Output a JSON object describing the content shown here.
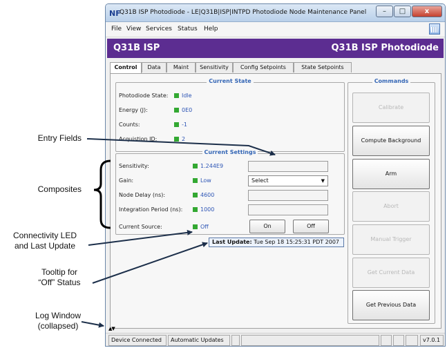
{
  "annotations": {
    "entry_fields": "Entry Fields",
    "composites": "Composites",
    "connectivity_line1": "Connectivity LED",
    "connectivity_line2": "and Last Update",
    "tooltip_line1": "Tooltip for",
    "tooltip_line2": "“Off” Status",
    "log_line1": "Log Window",
    "log_line2": "(collapsed)"
  },
  "window": {
    "logo": "NF",
    "title": "Q31B ISP Photodiode - LE|Q31B|ISP|INTPD  Photodiode Node Maintenance Panel",
    "min": "–",
    "max": "□",
    "close": "x"
  },
  "menu": [
    "File",
    "View",
    "Services",
    "Status",
    "Help"
  ],
  "header": {
    "left": "Q31B  ISP",
    "right": "Q31B ISP Photodiode"
  },
  "tabs": [
    "Control",
    "Data",
    "Maint",
    "Sensitivity",
    "Config Setpoints",
    "State Setpoints"
  ],
  "current_state": {
    "title": "Current State",
    "rows": [
      {
        "label": "Photodiode State:",
        "value": "Idle"
      },
      {
        "label": "Energy (J):",
        "value": "0E0"
      },
      {
        "label": "Counts:",
        "value": "-1"
      },
      {
        "label": "Acquistion ID:",
        "value": "2"
      }
    ]
  },
  "current_settings": {
    "title": "Current Settings",
    "rows": [
      {
        "label": "Sensitivity:",
        "value": "1.244E9"
      },
      {
        "label": "Gain:",
        "value": "Low",
        "select": "Select"
      },
      {
        "label": "Node Delay (ns):",
        "value": "4600"
      },
      {
        "label": "Integration Period (ns):",
        "value": "1000"
      },
      {
        "label": "Current Source:",
        "value": "Off"
      }
    ],
    "on_button": "On",
    "off_button": "Off"
  },
  "tooltip": {
    "label": "Last Update:",
    "value": "Tue Sep 18 15:25:31 PDT 2007"
  },
  "commands": {
    "title": "Commands",
    "buttons": [
      {
        "label": "Calibrate",
        "enabled": false
      },
      {
        "label": "Compute Background",
        "enabled": true
      },
      {
        "label": "Arm",
        "enabled": true
      },
      {
        "label": "Abort",
        "enabled": false
      },
      {
        "label": "Manual Trigger",
        "enabled": false
      },
      {
        "label": "Get Current Data",
        "enabled": false
      },
      {
        "label": "Get Previous Data",
        "enabled": true
      }
    ]
  },
  "log_toggle": "▲▼",
  "statusbar": {
    "connected": "Device Connected",
    "updates": "Automatic Updates",
    "version": "v7.0.1"
  },
  "colors": {
    "header_bg": "#5c2d91",
    "led": "#33a832",
    "value_text": "#2d55b5",
    "group_title": "#3466b5"
  }
}
